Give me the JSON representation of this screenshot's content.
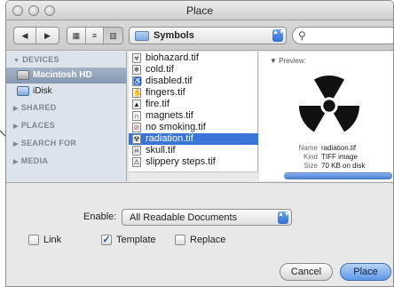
{
  "window": {
    "title": "Place"
  },
  "toolbar": {
    "back_glyph": "◀",
    "forward_glyph": "▶",
    "view_icons": [
      "icon-view-icon",
      "list-view-icon",
      "column-view-icon"
    ],
    "view_glyphs": [
      "▦",
      "≡",
      "▥"
    ],
    "path_label": "Symbols",
    "path_arrows": "▲▼",
    "search_placeholder": ""
  },
  "sidebar": {
    "sections": [
      {
        "label": "DEVICES",
        "expanded": true
      },
      {
        "label": "SHARED",
        "expanded": false
      },
      {
        "label": "PLACES",
        "expanded": false
      },
      {
        "label": "SEARCH FOR",
        "expanded": false
      },
      {
        "label": "MEDIA",
        "expanded": false
      }
    ],
    "devices": [
      {
        "label": "Macintosh HD",
        "icon": "hard-drive-icon",
        "selected": true
      },
      {
        "label": "iDisk",
        "icon": "idisk-icon",
        "selected": false
      }
    ]
  },
  "files": [
    {
      "name": "biohazard.tif",
      "icon": "☣",
      "selected": false
    },
    {
      "name": "cold.tif",
      "icon": "❄",
      "selected": false
    },
    {
      "name": "disabled.tif",
      "icon": "♿",
      "selected": false
    },
    {
      "name": "fingers.tif",
      "icon": "✋",
      "selected": false
    },
    {
      "name": "fire.tif",
      "icon": "▲",
      "selected": false
    },
    {
      "name": "magnets.tif",
      "icon": "∩",
      "selected": false
    },
    {
      "name": "no smoking.tif",
      "icon": "⊘",
      "selected": false
    },
    {
      "name": "radiation.tif",
      "icon": "☢",
      "selected": true
    },
    {
      "name": "skull.tif",
      "icon": "☠",
      "selected": false
    },
    {
      "name": "slippery steps.tif",
      "icon": "⚠",
      "selected": false
    }
  ],
  "preview": {
    "heading": "Preview:",
    "name_key": "Name",
    "name_value": "radiation.tif",
    "kind_key": "Kind",
    "kind_value": "TIFF image",
    "size_key": "Size",
    "size_value": "70 KB on disk"
  },
  "options": {
    "enable_label": "Enable:",
    "enable_value": "All Readable Documents",
    "link_label": "Link",
    "link_checked": false,
    "template_label": "Template",
    "template_checked": true,
    "replace_label": "Replace",
    "replace_checked": false,
    "check_mark": "✓"
  },
  "buttons": {
    "cancel": "Cancel",
    "place": "Place"
  },
  "colors": {
    "selection": "#3875d7",
    "sidebar": "#dde3ea",
    "default_button": "#5c96e6"
  }
}
